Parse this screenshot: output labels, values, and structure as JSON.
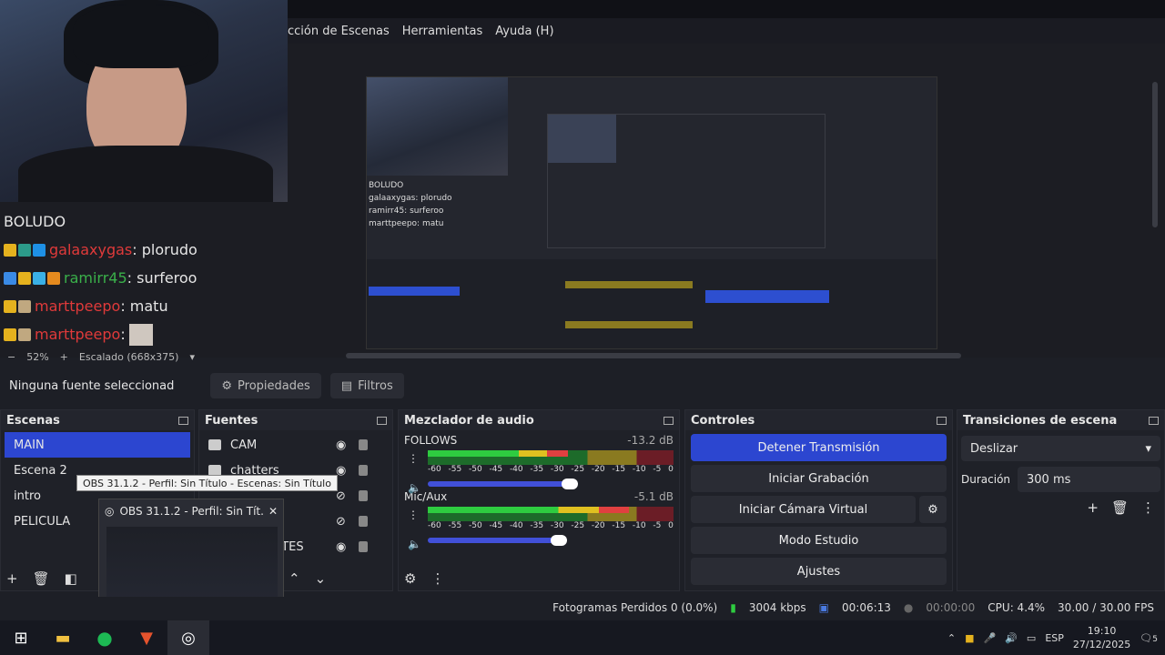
{
  "menu": [
    "cción de Escenas",
    "Herramientas",
    "Ayuda (H)"
  ],
  "chat": [
    {
      "user": "",
      "text": "BOLUDO",
      "user_color": "#e03a3a"
    },
    {
      "user": "galaaxygas",
      "text": ": plorudo",
      "user_color": "#e03a3a"
    },
    {
      "user": "ramirr45",
      "text": ": surferoo",
      "user_color": "#3ab04a"
    },
    {
      "user": "marttpeepo",
      "text": ": matu",
      "user_color": "#e03a3a"
    },
    {
      "user": "marttpeepo",
      "text": ":",
      "user_color": "#e03a3a"
    }
  ],
  "preview": {
    "zoom": "52%",
    "scale": "Escalado (668x375)"
  },
  "source_bar": {
    "none_selected": "Ninguna fuente seleccionad",
    "properties": "Propiedades",
    "filters": "Filtros"
  },
  "scenes": {
    "title": "Escenas",
    "items": [
      "MAIN",
      "Escena 2",
      "intro",
      "PELICULA"
    ]
  },
  "sources": {
    "title": "Fuentes",
    "items": [
      "CAM",
      "chatters",
      "",
      "",
      "OTES"
    ]
  },
  "mixer": {
    "title": "Mezclador de audio",
    "tracks": [
      {
        "name": "FOLLOWS",
        "db": "-13.2 dB",
        "level": 0.57,
        "volume": 0.82
      },
      {
        "name": "Mic/Aux",
        "db": "-5.1 dB",
        "level": 0.82,
        "volume": 0.76
      }
    ],
    "ticks": [
      "-60",
      "-55",
      "-50",
      "-45",
      "-40",
      "-35",
      "-30",
      "-25",
      "-20",
      "-15",
      "-10",
      "-5",
      "0"
    ]
  },
  "controls": {
    "title": "Controles",
    "stop_stream": "Detener Transmisión",
    "start_record": "Iniciar Grabación",
    "start_vcam": "Iniciar Cámara Virtual",
    "studio_mode": "Modo Estudio",
    "settings": "Ajustes"
  },
  "transitions": {
    "title": "Transiciones de escena",
    "selected": "Deslizar",
    "duration_label": "Duración",
    "duration_value": "300 ms"
  },
  "status": {
    "dropped": "Fotogramas Perdidos 0 (0.0%)",
    "bitrate": "3004 kbps",
    "stream_time": "00:06:13",
    "record_time": "00:00:00",
    "cpu": "CPU: 4.4%",
    "fps": "30.00 / 30.00 FPS"
  },
  "tooltip": "OBS 31.1.2 - Perfil: Sin Título - Escenas: Sin Título",
  "thumb_title": "OBS 31.1.2 - Perfil: Sin Tít...",
  "tray": {
    "lang": "ESP",
    "time": "19:10",
    "date": "27/12/2025",
    "notif": "5"
  },
  "colors": {
    "accent": "#2c46d0",
    "bg": "#1f2128"
  }
}
